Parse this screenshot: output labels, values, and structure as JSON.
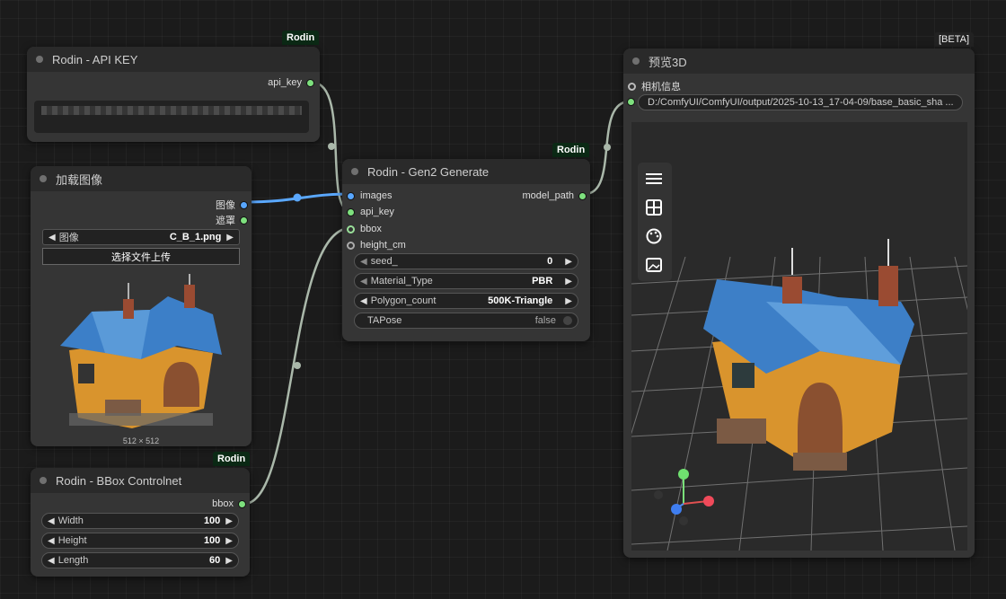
{
  "nodes": {
    "api_key": {
      "title": "Rodin - API KEY",
      "badge": "Rodin",
      "output": "api_key"
    },
    "load_image": {
      "title": "加载图像",
      "outputs": [
        "图像",
        "遮罩"
      ],
      "image_widget": {
        "label": "图像",
        "value": "C_B_1.png"
      },
      "upload_label": "选择文件上传",
      "dimensions": "512 × 512"
    },
    "bbox": {
      "title": "Rodin - BBox Controlnet",
      "badge": "Rodin",
      "output": "bbox",
      "widgets": [
        {
          "label": "Width",
          "value": "100"
        },
        {
          "label": "Height",
          "value": "100"
        },
        {
          "label": "Length",
          "value": "60"
        }
      ]
    },
    "gen2": {
      "title": "Rodin - Gen2 Generate",
      "badge": "Rodin",
      "inputs": [
        "images",
        "api_key",
        "bbox",
        "height_cm"
      ],
      "output": "model_path",
      "widgets": [
        {
          "label": "seed_",
          "value": "0"
        },
        {
          "label": "Material_Type",
          "value": "PBR"
        },
        {
          "label": "Polygon_count",
          "value": "500K-Triangle"
        }
      ],
      "toggle": {
        "label": "TAPose",
        "value": "false"
      }
    },
    "preview": {
      "title": "预览3D",
      "badge": "[BETA]",
      "inputs": [
        "相机信息"
      ],
      "path_value": "D:/ComfyUI/ComfyUI/output/2025-10-13_17-04-09/base_basic_sha ...",
      "toolbar": [
        "menu-icon",
        "grid-icon",
        "palette-icon",
        "image-icon"
      ]
    }
  }
}
